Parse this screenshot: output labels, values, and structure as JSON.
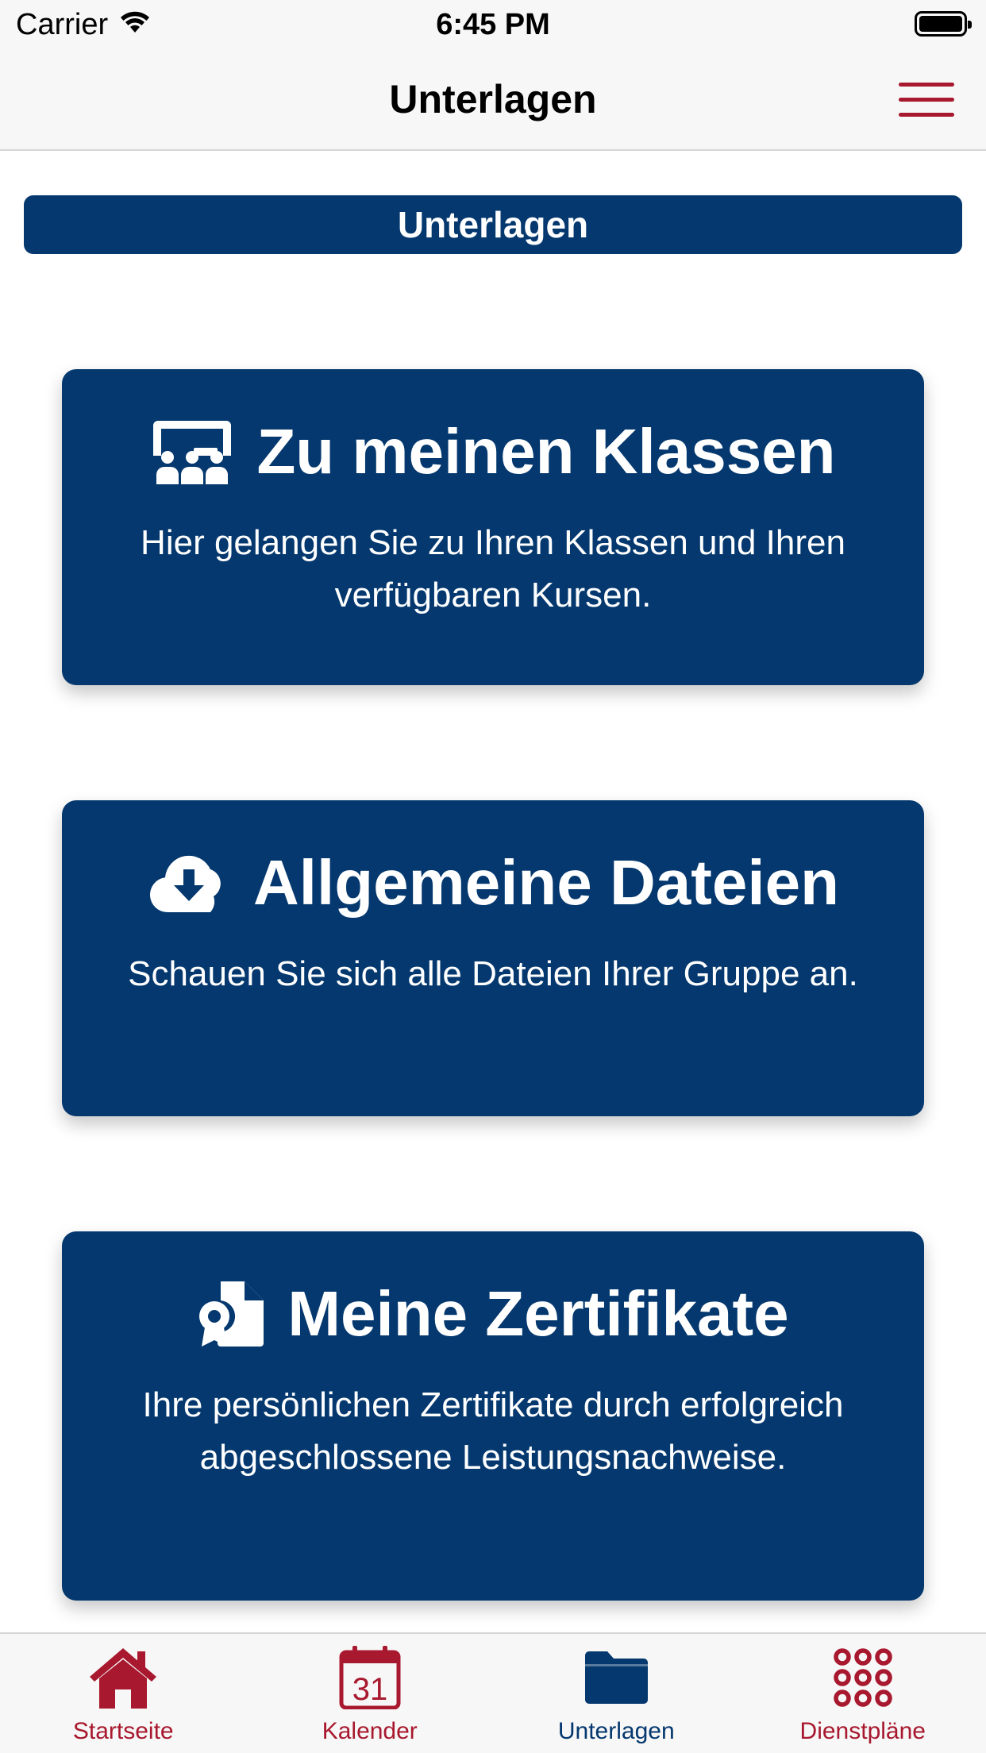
{
  "status_bar": {
    "carrier": "Carrier",
    "time": "6:45 PM"
  },
  "nav": {
    "title": "Unterlagen"
  },
  "section": {
    "title": "Unterlagen"
  },
  "cards": [
    {
      "title": "Zu meinen Klassen",
      "description": "Hier gelangen Sie zu Ihren Klassen und Ihren verfügbaren Kursen.",
      "icon": "classroom-icon"
    },
    {
      "title": "Allgemeine Dateien",
      "description": "Schauen Sie sich alle Dateien Ihrer Gruppe an.",
      "icon": "cloud-download-icon"
    },
    {
      "title": "Meine Zertifikate",
      "description": "Ihre persönlichen Zertifikate durch erfolgreich abgeschlossene Leistungsnachweise.",
      "icon": "certificate-icon"
    }
  ],
  "tabs": [
    {
      "label": "Startseite",
      "icon": "home-icon",
      "active": false
    },
    {
      "label": "Kalender",
      "icon": "calendar-icon",
      "icon_text": "31",
      "active": false
    },
    {
      "label": "Unterlagen",
      "icon": "folder-icon",
      "active": true
    },
    {
      "label": "Dienstpläne",
      "icon": "grid-dots-icon",
      "active": false
    }
  ],
  "colors": {
    "primary": "#04386e",
    "accent": "#a8182e",
    "background": "#ffffff",
    "bar": "#f7f7f7"
  }
}
